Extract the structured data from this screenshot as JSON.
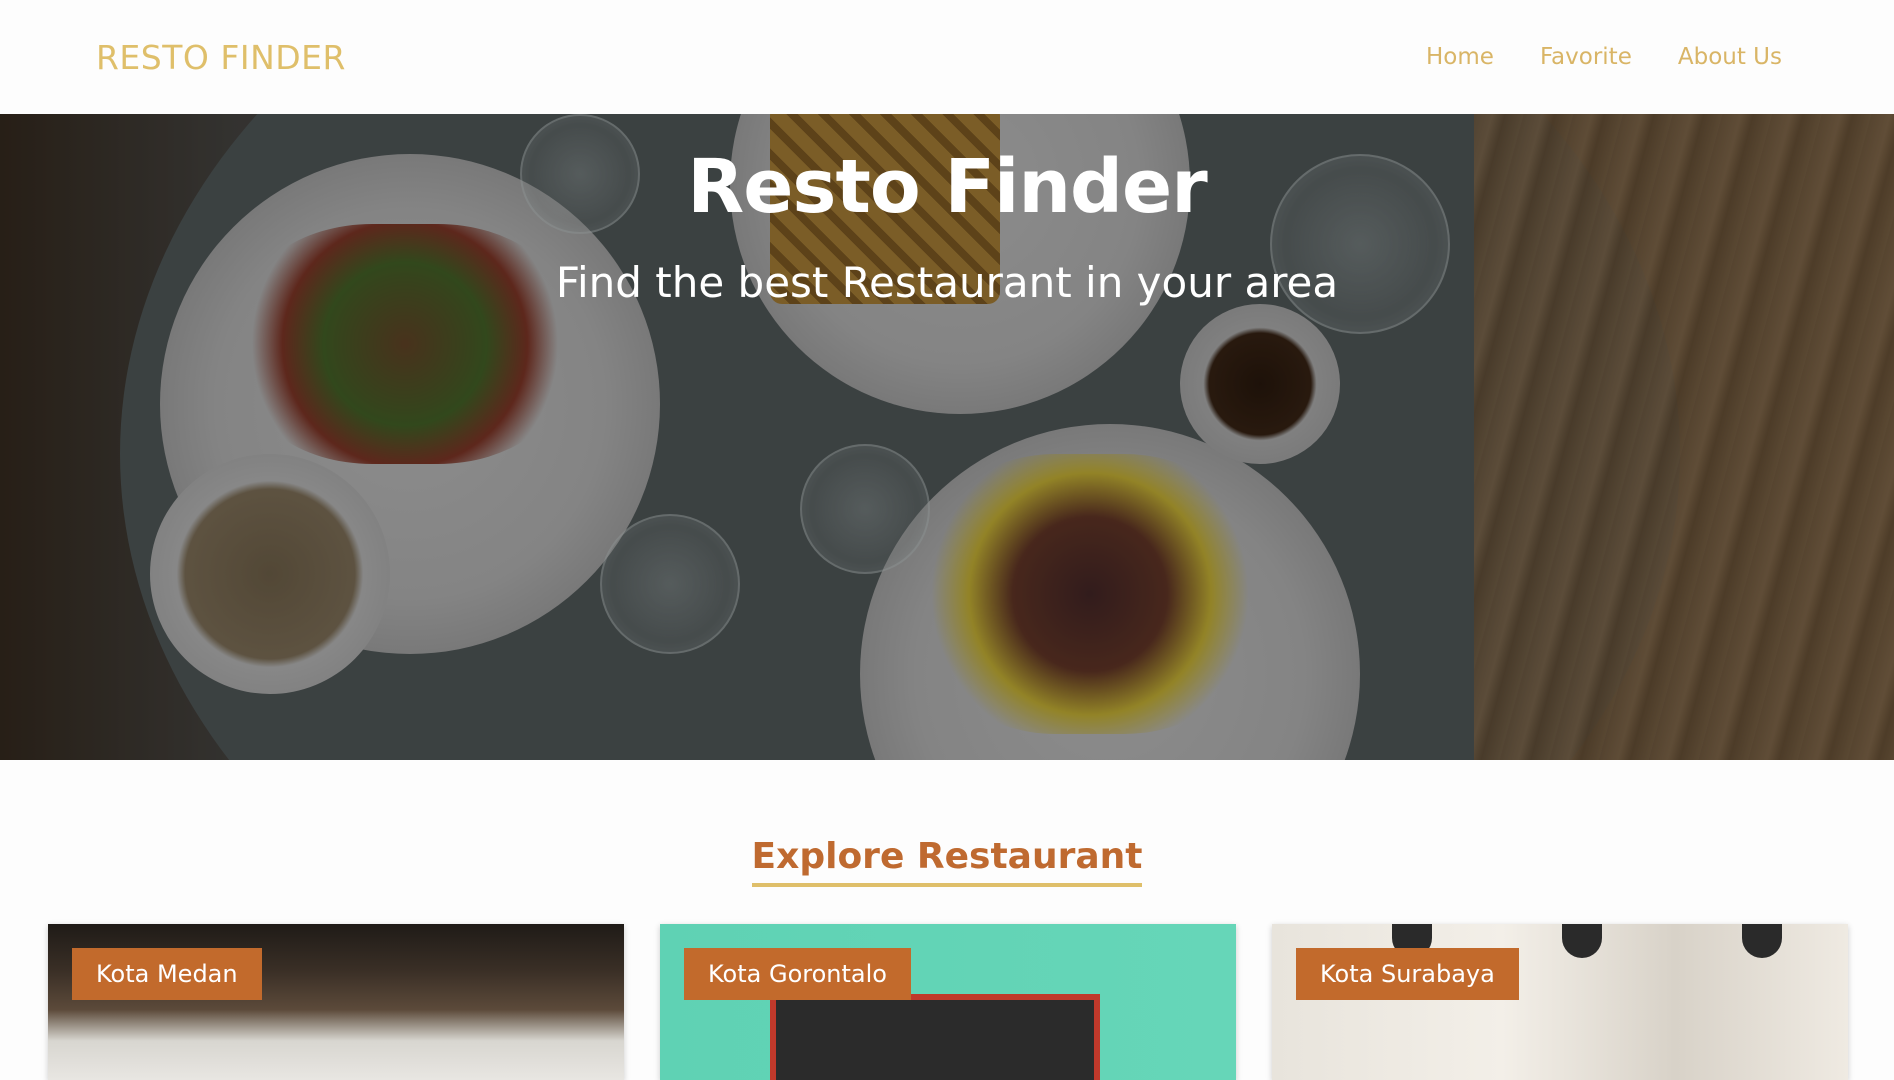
{
  "navbar": {
    "brand": "RESTO FINDER",
    "links": [
      {
        "label": "Home"
      },
      {
        "label": "Favorite"
      },
      {
        "label": "About Us"
      }
    ]
  },
  "hero": {
    "title": "Resto Finder",
    "subtitle": "Find the best Restaurant in your area"
  },
  "explore": {
    "title": "Explore Restaurant",
    "cards": [
      {
        "label": "Kota Medan"
      },
      {
        "label": "Kota Gorontalo"
      },
      {
        "label": "Kota Surabaya"
      }
    ]
  },
  "colors": {
    "brand": "#dfbf6a",
    "nav_link": "#d9b566",
    "section_title": "#bf6a30",
    "underline": "#dfbf6a",
    "card_label_bg": "#c26a2c"
  }
}
